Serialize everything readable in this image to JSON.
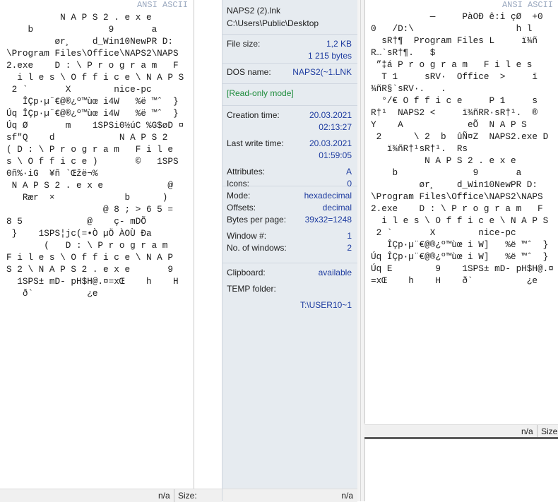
{
  "left_panel": {
    "mode_header": "ANSI ASCII",
    "text_lines": [
      "          N A P S 2 . e x e",
      "    b              9       a",
      "         ør¸    d_Win10NewPR D:",
      "\\Program Files\\Office\\NAPS2\\NAPS",
      "2.exe    D : \\ P r o g r a m   F",
      "  i l e s \\ O f f i c e \\ N A P S",
      " 2 `       X        nice-pc",
      "   ÎÇp·µ¨€@®¿º™ùœ i4W   %ë ™ˆ  }",
      "Úq ÎÇp·µ¨€@®¿º™ùœ i4W   %ë ™ˆ  }",
      "Úq Ø       m    1SPSi0½úC %G$øD ¤",
      "sf\"Q    d            N A P S 2",
      "( D : \\ P r o g r a m   F i l e",
      "s \\ O f f i c e )       ©   1SPS",
      "0ñ%·iG  ¥ñ `Œžë¬%",
      " N A P S 2 . e x e            @",
      "   Rær  ×             b      )",
      "                  @ 8 ; > 6 5 =",
      "8 5            @    ç- mDÕ",
      " }    1SPS¦jc(=•Ò µÖ ÀOÙ Đa",
      "       (   D : \\ P r o g r a m",
      "F i l e s \\ O f f i c e \\ N A P",
      "S 2 \\ N A P S 2 . e x e       9",
      "  1SPS± mD- pH$H@.¤=xŒ    h    H",
      "   ð`          ¿e"
    ],
    "status": {
      "na": "n/a",
      "size_label": "Size:"
    }
  },
  "info_panel": {
    "file_name": "NAPS2 (2).lnk",
    "file_path": "C:\\Users\\Public\\Desktop",
    "file_size_label": "File size:",
    "file_size_kb": "1,2 KB",
    "file_size_bytes": "1 215 bytes",
    "dos_name_label": "DOS name:",
    "dos_name": "NAPS2(~1.LNK",
    "read_only": "[Read-only mode]",
    "creation_label": "Creation time:",
    "creation_date": "20.03.2021",
    "creation_time": "02:13:27",
    "write_label": "Last write time:",
    "write_date": "20.03.2021",
    "write_time": "01:59:05",
    "attributes_label": "Attributes:",
    "attributes": "A",
    "icons_label": "Icons:",
    "icons": "0",
    "mode_label": "Mode:",
    "mode": "hexadecimal",
    "offsets_label": "Offsets:",
    "offsets": "decimal",
    "bpp_label": "Bytes per page:",
    "bpp": "39x32=1248",
    "window_label": "Window #:",
    "window": "1",
    "windows_label": "No. of windows:",
    "windows": "2",
    "clipboard_label": "Clipboard:",
    "clipboard": "available",
    "temp_label": "TEMP folder:",
    "temp": "T:\\USER10~1",
    "footer_na": "n/a"
  },
  "right_panel": {
    "mode_header": "ANSI ASCII",
    "text_lines": [
      "           —     PàOĐ ê:i çØ  +0",
      "0   /D:\\                   h l",
      "  sR†¶  Program Files L     ï¾ñ",
      "R…`sR†¶.   $",
      " ”‡á P r o g r a m   F i l e s",
      "  T 1     sRV·  Office  >     ï",
      "¾ñR§`sRV·.   .",
      "  °/€ O f f i c e     P 1     s",
      "R†¹  NAPS2 <     ï¾ñRR·sR†¹.  ®",
      "Y    A            eÕ  N A P S",
      " 2      \\ 2  b  ûÑ¤Z  NAPS2.exe D",
      "   ï¾ñR†¹sR†¹.  Rs",
      "          N A P S 2 . e x e",
      "    b              9       a",
      "         ør¸    d_Win10NewPR D:",
      "\\Program Files\\Office\\NAPS2\\NAPS",
      "2.exe    D : \\ P r o g r a m   F",
      "  i l e s \\ O f f i c e \\ N A P S",
      " 2 `       X        nice-pc",
      "   ÎÇp·µ¨€@®¿º™ùœ i W]   %ë ™ˆ  }",
      "Úq ÎÇp·µ¨€@®¿º™ùœ i W]   %ë ™ˆ  }",
      "Úq E        9    1SPS± mD- pH$H@.¤",
      "=xŒ    h    H    ð`          ¿e"
    ],
    "status": {
      "na": "n/a",
      "size_label": "Size:"
    }
  }
}
